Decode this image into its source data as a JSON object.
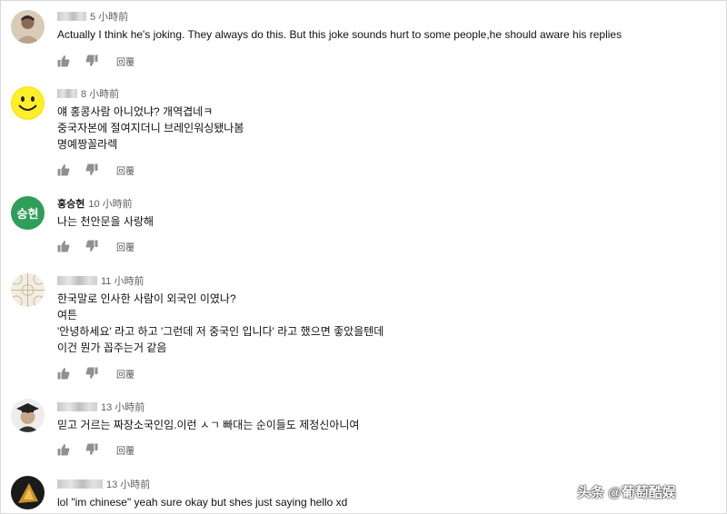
{
  "reply_label": "回覆",
  "watermark": "头条 @葡萄酷娱",
  "comments": [
    {
      "avatar": "avatar-photo-icon",
      "name": "",
      "time": "5 小時前",
      "lines": [
        "Actually I think he's joking. They always do this. But this joke sounds hurt to some people,he should aware his replies"
      ]
    },
    {
      "avatar": "smiley-face-icon",
      "name": "",
      "time": "8 小時前",
      "lines": [
        "얘 홍콩사람 아니었냐? 개역겹네ㅋ",
        "중국자본에 절여지더니 브레인워싱됐나봄",
        "명예짱꼴라렉"
      ]
    },
    {
      "avatar": "initials-avatar",
      "avatar_text": "승현",
      "avatar_color": "#2e9e58",
      "name": "홍승현",
      "time": "10 小時前",
      "lines": [
        "나는 천안문을 사랑해"
      ]
    },
    {
      "avatar": "pattern-avatar-icon",
      "name": "",
      "time": "11 小時前",
      "lines": [
        "한국말로 인사한 사람이 외국인 이였나?",
        "여튼",
        "'안녕하세요' 라고 하고 '그런데 저 중국인 입니다' 라고 했으면 좋았을텐데",
        "이건 뭔가 꼽주는거 같음"
      ]
    },
    {
      "avatar": "graduate-avatar-icon",
      "name": "",
      "time": "13 小時前",
      "lines": [
        "믿고 거르는 짜장소국인임.이런 ㅅㄱ 빠대는 순이들도 제정신아니여"
      ]
    },
    {
      "avatar": "dark-photo-avatar-icon",
      "name": "",
      "time": "13 小時前",
      "lines": [
        "lol \"im chinese\" yeah sure okay but shes just saying hello xd"
      ]
    }
  ]
}
